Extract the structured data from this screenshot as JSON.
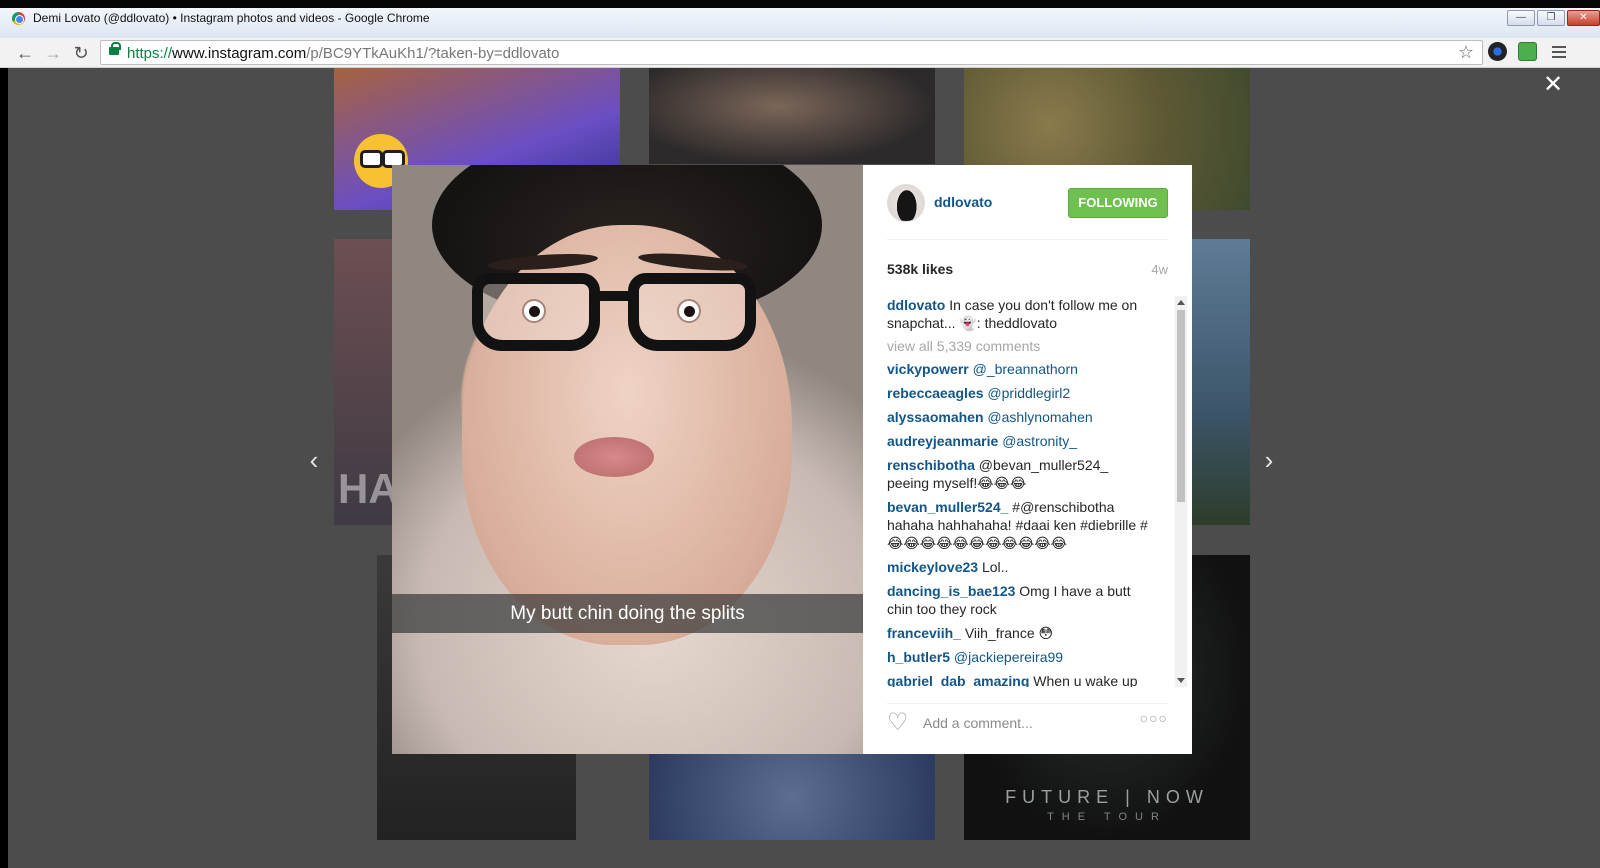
{
  "window": {
    "title": "Demi Lovato (@ddlovato) • Instagram photos and videos - Google Chrome",
    "min_label": "—",
    "max_label": "❐",
    "close_label": "✕"
  },
  "toolbar": {
    "back_icon": "←",
    "forward_icon": "→",
    "reload_icon": "↻",
    "url_scheme": "https://",
    "url_host": "www.instagram.com",
    "url_path": "/p/BC9YTkAuKh1/?taken-by=ddlovato",
    "star_icon": "☆"
  },
  "page": {
    "close_icon": "✕",
    "prev_icon": "‹",
    "next_icon": "›",
    "tile_text_ha": "HA",
    "tour_line1": "FUTURE | NOW",
    "tour_line2": "THE TOUR"
  },
  "post": {
    "photo_caption": "My butt chin doing the splits",
    "username": "ddlovato",
    "follow_label": "FOLLOWING",
    "likes": "538k likes",
    "age": "4w",
    "caption_user": "ddlovato",
    "caption_text": "In case you don't follow me on snapchat... 👻: theddlovato",
    "view_all": "view all 5,339 comments",
    "comments": [
      {
        "user": "vickypowerr",
        "text": "@_breannathorn"
      },
      {
        "user": "rebeccaeagles",
        "text": "@priddlegirl2"
      },
      {
        "user": "alyssaomahen",
        "text": "@ashlynomahen"
      },
      {
        "user": "audreyjeanmarie",
        "text": "@astronity_"
      },
      {
        "user": "renschibotha",
        "text": "@bevan_muller524_ peeing myself!😂😂😂"
      },
      {
        "user": "bevan_muller524_",
        "text": "#@renschibotha hahaha hahhahaha! #daai ken #diebrille #😂😂😂😂😂😂😂😂😂😂😂"
      },
      {
        "user": "mickeylove23",
        "text": "Lol.."
      },
      {
        "user": "dancing_is_bae123",
        "text": "Omg I have a butt chin too they rock"
      },
      {
        "user": "franceviih_",
        "text": "Viih_france 😳"
      },
      {
        "user": "h_butler5",
        "text": "@jackiepereira99"
      },
      {
        "user": "gabriel_dab_amazing",
        "text": "When u wake up"
      }
    ],
    "heart_icon": "♡",
    "comment_placeholder": "Add a comment...",
    "more_icon": "○○○"
  }
}
